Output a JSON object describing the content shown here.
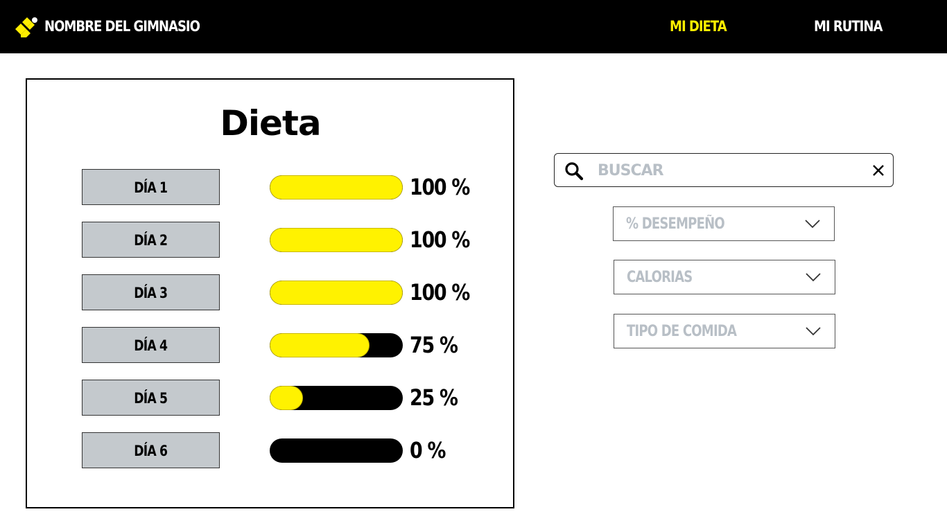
{
  "navbar": {
    "brand": "NOMBRE DEL GIMNASIO",
    "links": [
      {
        "label": "MI DIETA",
        "active": true
      },
      {
        "label": "MI RUTINA",
        "active": false
      }
    ]
  },
  "panel": {
    "title": "Dieta",
    "days": [
      {
        "label": "DÍA 1",
        "progress": 100,
        "progress_text": "100 %"
      },
      {
        "label": "DÍA 2",
        "progress": 100,
        "progress_text": "100 %"
      },
      {
        "label": "DÍA 3",
        "progress": 100,
        "progress_text": "100 %"
      },
      {
        "label": "DÍA 4",
        "progress": 75,
        "progress_text": "75 %"
      },
      {
        "label": "DÍA 5",
        "progress": 25,
        "progress_text": "25 %"
      },
      {
        "label": "DÍA 6",
        "progress": 0,
        "progress_text": "0 %"
      }
    ]
  },
  "search": {
    "placeholder": "BUSCAR",
    "value": ""
  },
  "filters": [
    {
      "label": "% DESEMPEÑO"
    },
    {
      "label": "CALORIAS"
    },
    {
      "label": "TIPO DE COMIDA"
    }
  ],
  "icons": {
    "logo": "gym-logo-icon",
    "search": "search-icon",
    "clear": "close-icon",
    "dropdown": "chevron-down-icon"
  },
  "colors": {
    "navbar_bg": "#000000",
    "accent": "#fff200",
    "button_bg": "#c4c9cd",
    "placeholder": "#b8bfc6"
  }
}
